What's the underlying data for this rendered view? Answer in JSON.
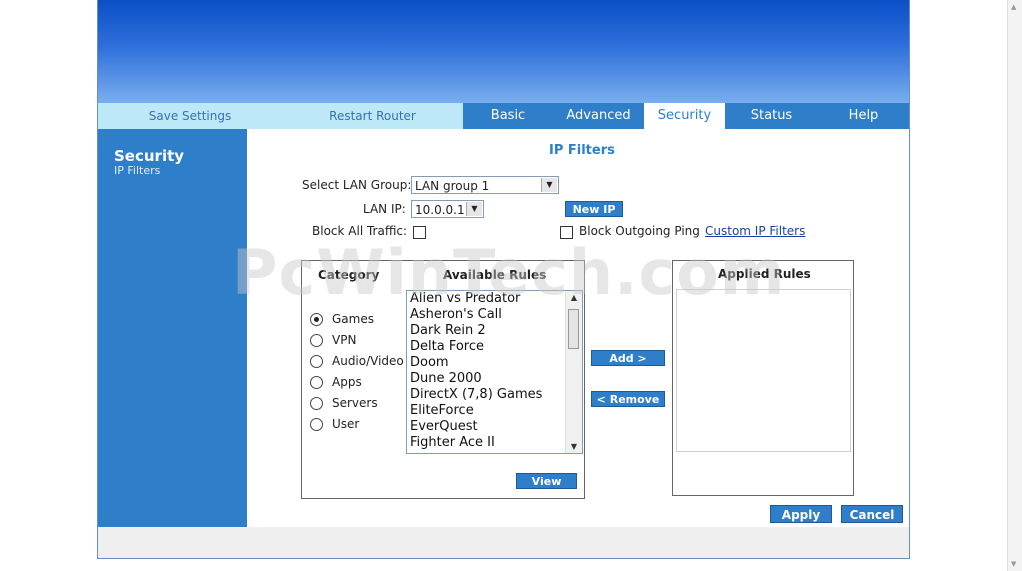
{
  "nav": {
    "save_settings": "Save Settings",
    "restart_router": "Restart Router",
    "tabs": [
      "Basic",
      "Advanced",
      "Security",
      "Status",
      "Help"
    ],
    "active_tab": "Security"
  },
  "sidebar": {
    "title": "Security",
    "subtitle": "IP Filters"
  },
  "page": {
    "title": "IP Filters"
  },
  "form": {
    "lan_group_label": "Select LAN Group:",
    "lan_group_value": "LAN group 1",
    "lan_ip_label": "LAN IP:",
    "lan_ip_value": "10.0.0.1",
    "new_ip_button": "New IP",
    "block_all_label": "Block All Traffic:",
    "block_ping_label": "Block Outgoing Ping",
    "custom_link": "Custom IP Filters"
  },
  "category": {
    "header": "Category",
    "options": [
      "Games",
      "VPN",
      "Audio/Video",
      "Apps",
      "Servers",
      "User"
    ],
    "selected": "Games"
  },
  "available": {
    "header": "Available Rules",
    "items": [
      "Alien vs Predator",
      "Asheron's Call",
      "Dark Rein 2",
      "Delta Force",
      "Doom",
      "Dune 2000",
      "DirectX (7,8) Games",
      "EliteForce",
      "EverQuest",
      "Fighter Ace II"
    ],
    "view_button": "View"
  },
  "applied": {
    "header": "Applied Rules",
    "items": []
  },
  "actions": {
    "add": "Add >",
    "remove": "< Remove",
    "apply": "Apply",
    "cancel": "Cancel"
  },
  "watermark": "PcWinTech.com",
  "colors": {
    "tab_blue": "#2e7ec9",
    "light_nav": "#bde8f7",
    "banner_top": "#0b4fc8"
  }
}
